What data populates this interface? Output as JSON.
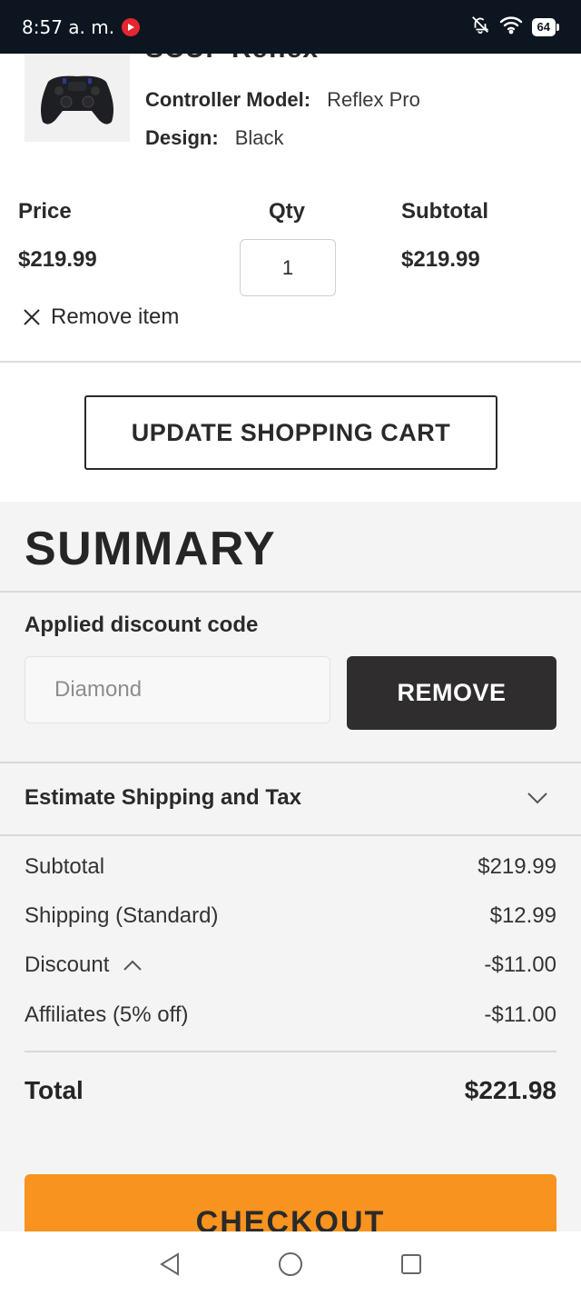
{
  "status_bar": {
    "time": "8:57 a. m.",
    "battery": "64"
  },
  "product": {
    "name": "SCUF Reflex",
    "attributes": [
      {
        "key": "Controller Model:",
        "value": "Reflex Pro"
      },
      {
        "key": "Design:",
        "value": "Black"
      }
    ],
    "price_label": "Price",
    "qty_label": "Qty",
    "subtotal_label": "Subtotal",
    "price": "$219.99",
    "qty": "1",
    "subtotal": "$219.99",
    "remove_label": "Remove item"
  },
  "cart": {
    "update_label": "UPDATE SHOPPING CART"
  },
  "summary": {
    "title": "SUMMARY",
    "discount_label": "Applied discount code",
    "discount_code": "Diamond",
    "remove_label": "REMOVE",
    "shipping_toggle_label": "Estimate Shipping and Tax",
    "lines": [
      {
        "label": "Subtotal",
        "value": "$219.99"
      },
      {
        "label": "Shipping (Standard)",
        "value": "$12.99"
      },
      {
        "label": "Discount",
        "value": "-$11.00"
      },
      {
        "label": "Affiliates (5% off)",
        "value": "-$11.00"
      }
    ],
    "total_label": "Total",
    "total_value": "$221.98",
    "checkout_label": "CHECKOUT"
  },
  "colors": {
    "accent": "#f7931e",
    "dark_button": "#2f2d2e",
    "status_bar": "#0d1520"
  }
}
